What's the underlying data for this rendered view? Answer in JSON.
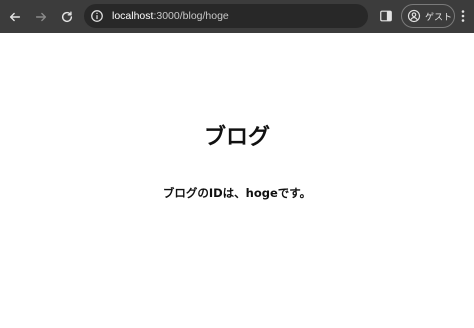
{
  "browser": {
    "url_host": "localhost",
    "url_rest": ":3000/blog/hoge",
    "profile_label": "ゲスト",
    "icons": {
      "back": "arrow-left-icon",
      "forward": "arrow-right-icon",
      "reload": "reload-icon",
      "site_info": "info-icon",
      "side_panel": "side-panel-icon",
      "profile": "person-icon",
      "menu": "kebab-menu-icon"
    },
    "colors": {
      "toolbar": "#3c3c3c",
      "omnibox": "#282828"
    }
  },
  "page": {
    "heading": "ブログ",
    "description": "ブログのIDは、hogeです。"
  }
}
